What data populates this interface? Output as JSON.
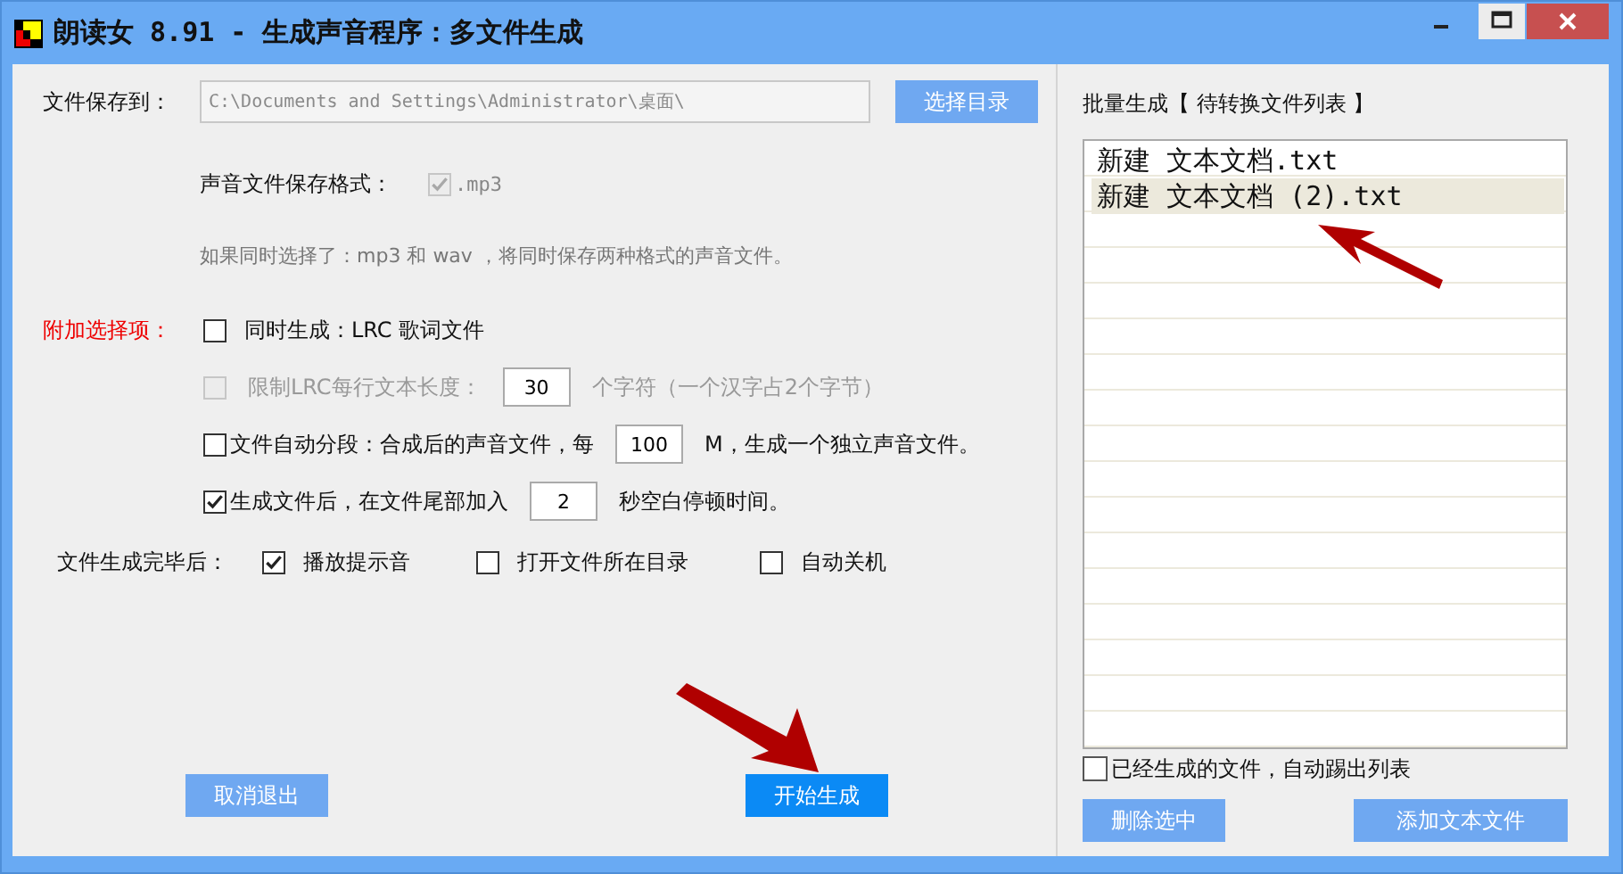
{
  "window": {
    "title": "朗读女 8.91 - 生成声音程序：多文件生成"
  },
  "save_to": {
    "label": "文件保存到：",
    "path": "C:\\Documents and Settings\\Administrator\\桌面\\",
    "button": "选择目录"
  },
  "format": {
    "label": "声音文件保存格式：",
    "option": {
      "label": ".mp3",
      "checked": true,
      "disabled": true
    }
  },
  "note": "如果同时选择了：mp3 和 wav ，将同时保存两种格式的声音文件。",
  "extras": {
    "label": "附加选择项：",
    "options": [
      {
        "kind": "plain",
        "label": "同时生成：LRC 歌词文件",
        "checked": false,
        "disabled": false
      },
      {
        "kind": "field",
        "label": "限制LRC每行文本长度：",
        "value": "30",
        "after": "个字符（一个汉字占2个字节）",
        "checked": false,
        "disabled": true
      },
      {
        "kind": "field",
        "label": "文件自动分段：合成后的声音文件，每",
        "value": "100",
        "after": "M，生成一个独立声音文件。",
        "checked": false,
        "disabled": false
      },
      {
        "kind": "field",
        "label": "生成文件后，在文件尾部加入",
        "value": "2",
        "after": "秒空白停顿时间。",
        "checked": true,
        "disabled": false
      }
    ]
  },
  "after_done": {
    "label": "文件生成完毕后：",
    "options": [
      {
        "label": "播放提示音",
        "checked": true
      },
      {
        "label": "打开文件所在目录",
        "checked": false
      },
      {
        "label": "自动关机",
        "checked": false
      }
    ]
  },
  "buttons": [
    {
      "label": "取消退出",
      "focused": false
    },
    {
      "label": "开始生成",
      "focused": true
    }
  ],
  "batch": {
    "title": "批量生成【 待转换文件列表 】",
    "files": [
      {
        "name": "新建 文本文档.txt",
        "selected": false
      },
      {
        "name": "新建 文本文档 (2).txt",
        "selected": true
      }
    ],
    "auto_remove": {
      "label": "已经生成的文件，自动踢出列表",
      "checked": false
    },
    "buttons": [
      "删除选中",
      "添加文本文件"
    ]
  }
}
